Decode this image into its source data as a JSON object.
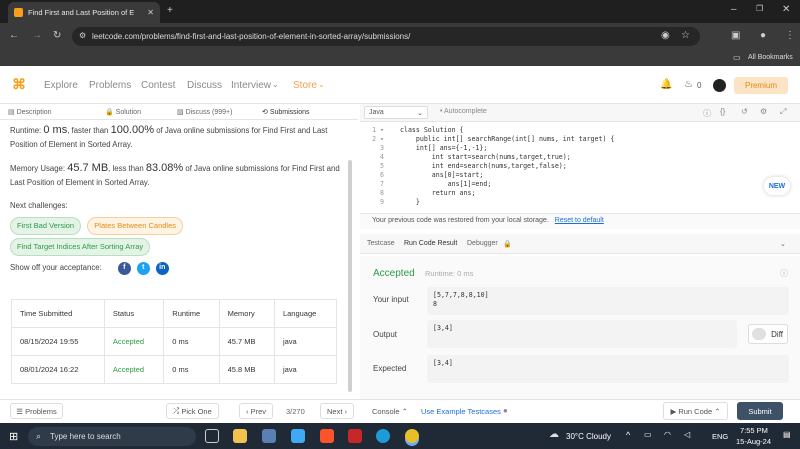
{
  "browser": {
    "tab_title": "Find First and Last Position of E",
    "url": "leetcode.com/problems/find-first-and-last-position-of-element-in-sorted-array/submissions/",
    "bookmarks_label": "All Bookmarks"
  },
  "nav": {
    "items": [
      "Explore",
      "Problems",
      "Contest",
      "Discuss",
      "Interview",
      "Store"
    ],
    "bell_count": "0",
    "premium": "Premium"
  },
  "left_tabs": [
    "Description",
    "Solution",
    "Discuss (999+)",
    "Submissions"
  ],
  "result": {
    "runtime_pre": "Runtime:",
    "runtime_val": "0 ms",
    "runtime_mid": ", faster than",
    "runtime_pct": "100.00%",
    "runtime_post": "of Java online submissions for Find First and Last Position of Element in Sorted Array.",
    "memory_pre": "Memory Usage:",
    "memory_val": "45.7 MB",
    "memory_mid": ", less than",
    "memory_pct": "83.08%",
    "memory_post": "of Java online submissions for Find First and Last Position of Element in Sorted Array."
  },
  "challenges": {
    "label": "Next challenges:",
    "items": [
      "First Bad Version",
      "Plates Between Candles",
      "Find Target Indices After Sorting Array"
    ]
  },
  "share_label": "Show off your acceptance:",
  "submissions": {
    "headers": [
      "Time Submitted",
      "Status",
      "Runtime",
      "Memory",
      "Language"
    ],
    "rows": [
      [
        "08/15/2024 19:55",
        "Accepted",
        "0 ms",
        "45.7 MB",
        "java"
      ],
      [
        "08/01/2024 16:22",
        "Accepted",
        "0 ms",
        "45.8 MB",
        "java"
      ]
    ]
  },
  "bottom": {
    "problems": "Problems",
    "pick_one": "Pick One",
    "prev": "Prev",
    "page": "3/270",
    "next": "Next",
    "console": "Console",
    "use_example": "Use Example Testcases",
    "run_code": "Run Code",
    "submit": "Submit"
  },
  "editor": {
    "language": "Java",
    "autocomplete": "Autocomplete",
    "code_lines": [
      "class Solution {",
      "    public int[] searchRange(int[] nums, int target) {",
      "    int[] ans={-1,-1};",
      "        int start=search(nums,target,true);",
      "        int end=search(nums,target,false);",
      "        ans[0]=start;",
      "            ans[1]=end;",
      "        return ans;",
      "    }"
    ],
    "restored_msg": "Your previous code was restored from your local storage.",
    "reset_link": "Reset to default",
    "new_badge": "NEW"
  },
  "run_tabs": [
    "Testcase",
    "Run Code Result",
    "Debugger"
  ],
  "run_result": {
    "status": "Accepted",
    "runtime": "Runtime: 0 ms",
    "your_input_label": "Your input",
    "your_input_line1": "[5,7,7,8,8,10]",
    "your_input_line2": "8",
    "output_label": "Output",
    "output": "[3,4]",
    "expected_label": "Expected",
    "expected": "[3,4]",
    "diff": "Diff"
  },
  "taskbar": {
    "search": "Type here to search",
    "weather": "30°C Cloudy",
    "lang": "ENG",
    "time": "7:55 PM",
    "date": "15-Aug-24"
  }
}
